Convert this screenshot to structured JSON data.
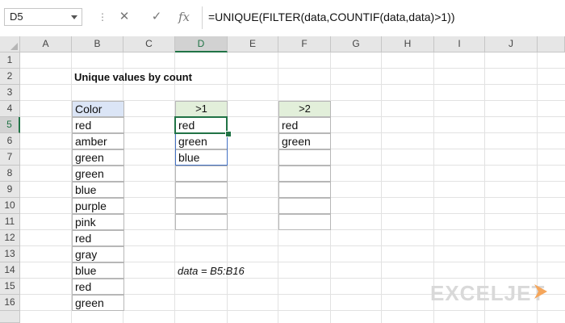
{
  "formula_bar": {
    "name_box": "D5",
    "dots": "⋮",
    "cancel_glyph": "✕",
    "enter_glyph": "✓",
    "fx_glyph": "fx",
    "formula": "=UNIQUE(FILTER(data,COUNTIF(data,data)>1))"
  },
  "columns": [
    "A",
    "B",
    "C",
    "D",
    "E",
    "F",
    "G",
    "H",
    "I",
    "J"
  ],
  "rows": [
    "1",
    "2",
    "3",
    "4",
    "5",
    "6",
    "7",
    "8",
    "9",
    "10",
    "11",
    "12",
    "13",
    "14",
    "15",
    "16"
  ],
  "selected_column": "D",
  "selected_row": "5",
  "sheet": {
    "title": "Unique values by count",
    "data_header": "Color",
    "data_values": [
      "red",
      "amber",
      "green",
      "green",
      "blue",
      "purple",
      "pink",
      "red",
      "gray",
      "blue",
      "red",
      "green"
    ],
    "result1_header": ">1",
    "result1_values": [
      "red",
      "green",
      "blue"
    ],
    "result2_header": ">2",
    "result2_values": [
      "red",
      "green"
    ],
    "note": "data = B5:B16"
  },
  "brand": {
    "logo_text": "EXCELJET",
    "accent": "#f5a65b"
  },
  "colors": {
    "header_blue": "#dbe5f6",
    "header_green": "#e2efda",
    "selection": "#217346",
    "spill_border": "#4472c4"
  }
}
